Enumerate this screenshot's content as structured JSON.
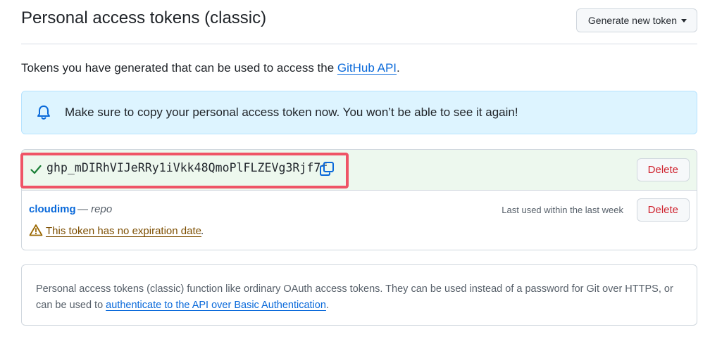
{
  "header": {
    "title": "Personal access tokens (classic)",
    "generate_button": "Generate new token"
  },
  "intro": {
    "text": "Tokens you have generated that can be used to access the ",
    "link": "GitHub API",
    "suffix": "."
  },
  "flash": {
    "icon": "bell-icon",
    "message": "Make sure to copy your personal access token now. You won’t be able to see it again!"
  },
  "tokens": [
    {
      "value": "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",
      "delete_label": "Delete",
      "highlighted": true
    },
    {
      "name": "cloudimg",
      "separator": "—",
      "scope": "repo",
      "last_used": "Last used within the last week",
      "warning": "This token has no expiration date",
      "warning_suffix": ".",
      "delete_label": "Delete"
    }
  ],
  "note": {
    "text": "Personal access tokens (classic) function like ordinary OAuth access tokens. They can be used instead of a password for Git over HTTPS, or can be used to ",
    "link": "authenticate to the API over Basic Authentication",
    "suffix": "."
  },
  "colors": {
    "link": "#0969da",
    "danger": "#cf222e",
    "highlight_border": "#ef5466",
    "success_bg": "#edf8ee",
    "info_bg": "#ddf4ff",
    "warning": "#9a6700"
  }
}
